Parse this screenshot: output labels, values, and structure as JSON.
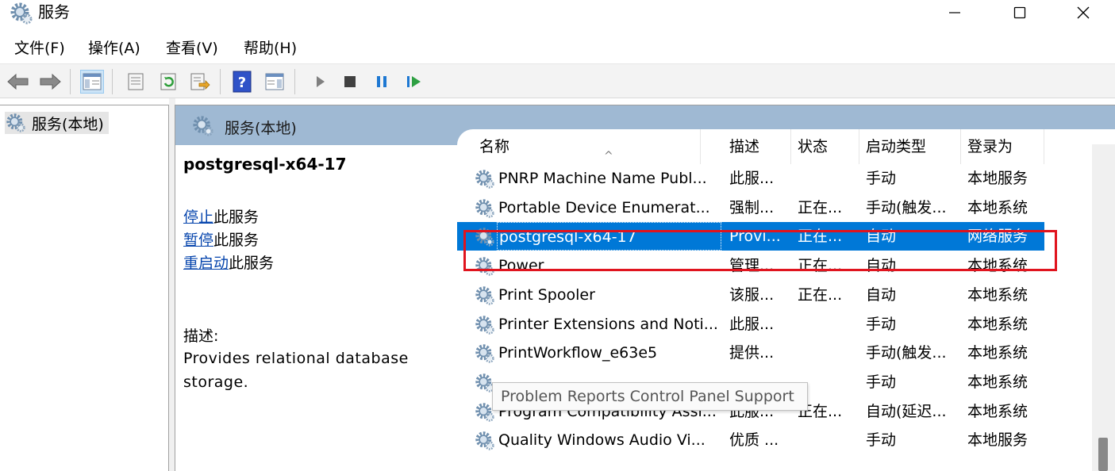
{
  "window": {
    "title": "服务"
  },
  "menu": [
    "文件(F)",
    "操作(A)",
    "查看(V)",
    "帮助(H)"
  ],
  "tree": {
    "root_label": "服务(本地)"
  },
  "panel": {
    "header": "服务(本地)"
  },
  "detail": {
    "service_name": "postgresql-x64-17",
    "actions": [
      {
        "link": "停止",
        "suffix": "此服务"
      },
      {
        "link": "暂停",
        "suffix": "此服务"
      },
      {
        "link": "重启动",
        "suffix": "此服务"
      }
    ],
    "description_label": "描述:",
    "description_text": "Provides relational database storage."
  },
  "list": {
    "columns": [
      "名称",
      "描述",
      "状态",
      "启动类型",
      "登录为"
    ],
    "rows": [
      {
        "name": "PNRP Machine Name Publ...",
        "desc": "此服...",
        "status": "",
        "startup": "手动",
        "logon": "本地服务"
      },
      {
        "name": "Portable Device Enumerat...",
        "desc": "强制...",
        "status": "正在...",
        "startup": "手动(触发...",
        "logon": "本地系统"
      },
      {
        "name": "postgresql-x64-17",
        "desc": "Provi...",
        "status": "正在...",
        "startup": "自动",
        "logon": "网络服务"
      },
      {
        "name": "Power",
        "desc": "管理...",
        "status": "正在...",
        "startup": "自动",
        "logon": "本地系统"
      },
      {
        "name": "Print Spooler",
        "desc": "该服...",
        "status": "正在...",
        "startup": "自动",
        "logon": "本地系统"
      },
      {
        "name": "Printer Extensions and Noti...",
        "desc": "此服...",
        "status": "",
        "startup": "手动",
        "logon": "本地系统"
      },
      {
        "name": "PrintWorkflow_e63e5",
        "desc": "提供...",
        "status": "",
        "startup": "手动(触发...",
        "logon": "本地系统"
      },
      {
        "name": "",
        "desc": "",
        "status": "",
        "startup": "手动",
        "logon": "本地系统"
      },
      {
        "name": "Program Compatibility Assi...",
        "desc": "此服...",
        "status": "正在...",
        "startup": "自动(延迟...",
        "logon": "本地系统"
      },
      {
        "name": "Quality Windows Audio Vi...",
        "desc": "优质 ...",
        "status": "",
        "startup": "手动",
        "logon": "本地服务"
      }
    ],
    "tooltip": "Problem Reports Control Panel Support"
  },
  "colors": {
    "selection": "#0078d7",
    "highlight": "#e0141e",
    "header": "#9fb9d3",
    "link": "#0645ad"
  }
}
